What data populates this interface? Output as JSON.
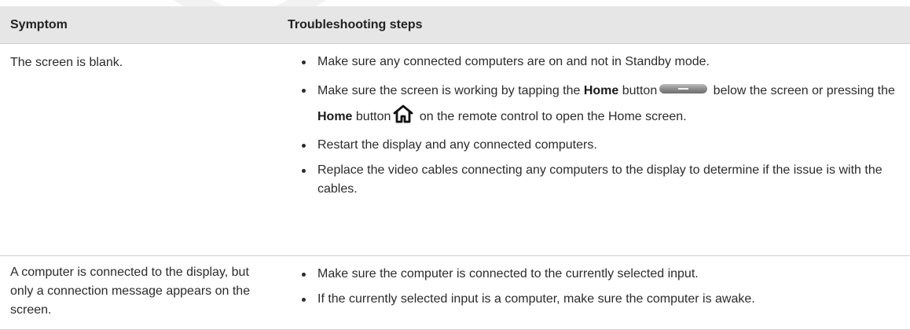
{
  "table": {
    "headers": {
      "symptom": "Symptom",
      "steps": "Troubleshooting steps"
    },
    "rows": [
      {
        "symptom": "The screen is blank.",
        "steps": [
          "Make sure any connected computers are on and not in Standby mode.",
          {
            "pre": "Make sure the screen is working by tapping the ",
            "bold1": "Home",
            "mid1": " button",
            "mid2": " below the screen or pressing the ",
            "bold2": "Home",
            "mid3": " button",
            "post": " on the remote control to open the Home screen."
          },
          "Restart the display and any connected computers.",
          "Replace the video cables connecting any computers to the display to determine if the issue is with the cables."
        ]
      },
      {
        "symptom": "A computer is connected to the display, but only a connection message appears on the screen.",
        "steps": [
          "Make sure the computer is connected to the currently selected input.",
          "If the currently selected input is a computer, make sure the computer is awake."
        ]
      }
    ]
  },
  "icons": {
    "home_button": "home-pill-button-icon",
    "remote_home": "house-outline-icon"
  }
}
